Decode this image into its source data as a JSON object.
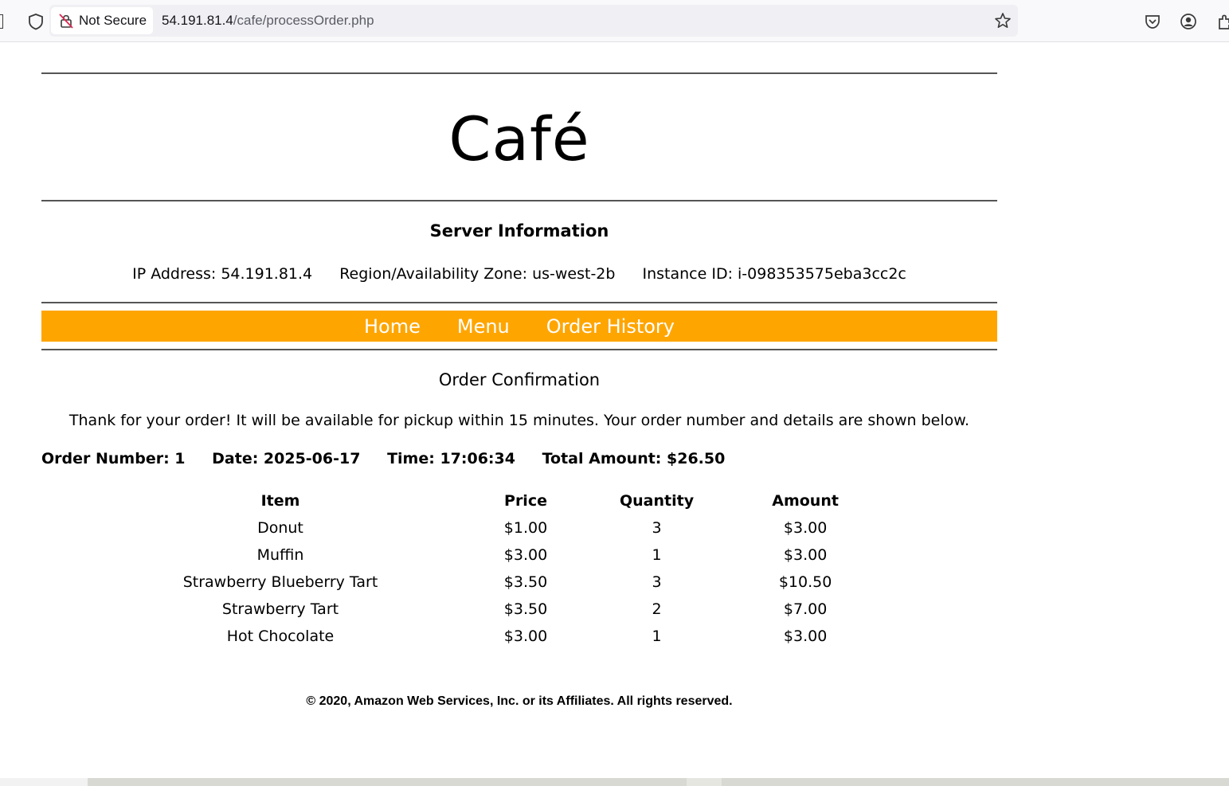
{
  "browser": {
    "security_label": "Not Secure",
    "url_host": "54.191.81.4",
    "url_path": "/cafe/processOrder.php"
  },
  "header": {
    "title": "Café"
  },
  "server": {
    "heading": "Server Information",
    "ip": "IP Address: 54.191.81.4",
    "region": "Region/Availability Zone: us-west-2b",
    "instance": "Instance ID: i-098353575eba3cc2c"
  },
  "nav": {
    "items": [
      {
        "label": "Home"
      },
      {
        "label": "Menu"
      },
      {
        "label": "Order History"
      }
    ]
  },
  "order": {
    "heading": "Order Confirmation",
    "thanks": "Thank for your order! It will be available for pickup within 15 minutes. Your order number and details are shown below.",
    "number": "Order Number: 1",
    "date": "Date: 2025-06-17",
    "time": "Time: 17:06:34",
    "total": "Total Amount: $26.50",
    "columns": [
      "Item",
      "Price",
      "Quantity",
      "Amount"
    ],
    "rows": [
      {
        "item": "Donut",
        "price": "$1.00",
        "quantity": "3",
        "amount": "$3.00"
      },
      {
        "item": "Muffin",
        "price": "$3.00",
        "quantity": "1",
        "amount": "$3.00"
      },
      {
        "item": "Strawberry Blueberry Tart",
        "price": "$3.50",
        "quantity": "3",
        "amount": "$10.50"
      },
      {
        "item": "Strawberry Tart",
        "price": "$3.50",
        "quantity": "2",
        "amount": "$7.00"
      },
      {
        "item": "Hot Chocolate",
        "price": "$3.00",
        "quantity": "1",
        "amount": "$3.00"
      }
    ]
  },
  "footer": {
    "copyright": "© 2020, Amazon Web Services, Inc. or its Affiliates. All rights reserved."
  },
  "colors": {
    "nav_background": "#ffa500",
    "nav_text": "#ffffff"
  }
}
